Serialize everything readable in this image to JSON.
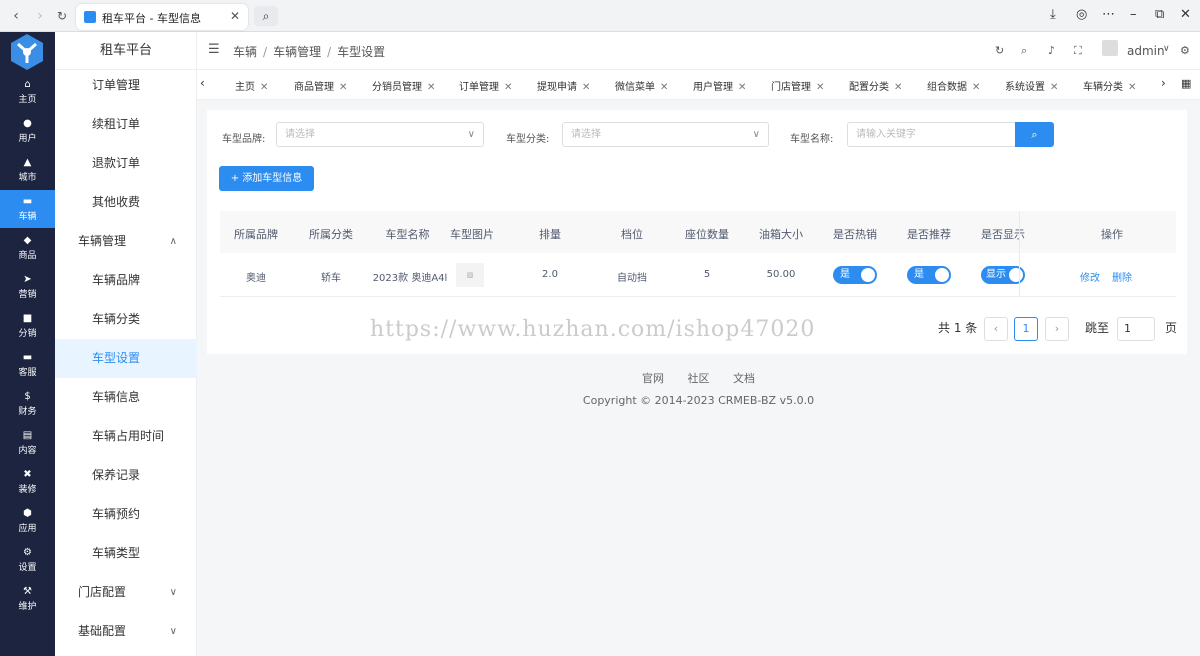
{
  "browser": {
    "tab_title": "租车平台 - 车型信息"
  },
  "sidebar_primary": [
    {
      "label": "主页",
      "icon": "home-icon"
    },
    {
      "label": "用户",
      "icon": "user-icon"
    },
    {
      "label": "城市",
      "icon": "city-icon"
    },
    {
      "label": "车辆",
      "icon": "car-icon"
    },
    {
      "label": "商品",
      "icon": "goods-icon"
    },
    {
      "label": "营销",
      "icon": "marketing-icon"
    },
    {
      "label": "分销",
      "icon": "distribution-icon"
    },
    {
      "label": "客服",
      "icon": "service-icon"
    },
    {
      "label": "财务",
      "icon": "finance-icon"
    },
    {
      "label": "内容",
      "icon": "content-icon"
    },
    {
      "label": "装修",
      "icon": "decorate-icon"
    },
    {
      "label": "应用",
      "icon": "app-icon"
    },
    {
      "label": "设置",
      "icon": "settings-icon"
    },
    {
      "label": "维护",
      "icon": "maintain-icon"
    }
  ],
  "sidebar_secondary": {
    "title": "租车平台",
    "items": [
      "订单管理",
      "续租订单",
      "退款订单",
      "其他收费",
      "车辆管理",
      "车辆品牌",
      "车辆分类",
      "车型设置",
      "车辆信息",
      "车辆占用时间",
      "保养记录",
      "车辆预约",
      "车辆类型",
      "门店配置",
      "基础配置"
    ]
  },
  "breadcrumb": [
    "车辆",
    "车辆管理",
    "车型设置"
  ],
  "user": {
    "name": "admin"
  },
  "tabs": [
    "主页",
    "商品管理",
    "分销员管理",
    "订单管理",
    "提现申请",
    "微信菜单",
    "用户管理",
    "门店管理",
    "配置分类",
    "组合数据",
    "系统设置",
    "车辆分类"
  ],
  "filters": {
    "brand_label": "车型品牌:",
    "brand_placeholder": "请选择",
    "category_label": "车型分类:",
    "category_placeholder": "请选择",
    "name_label": "车型名称:",
    "name_placeholder": "请输入关键字"
  },
  "add_button": "+ 添加车型信息",
  "table": {
    "headers": [
      "所属品牌",
      "所属分类",
      "车型名称",
      "车型图片",
      "排量",
      "档位",
      "座位数量",
      "油箱大小",
      "是否热销",
      "是否推荐",
      "是否显示",
      "操作"
    ],
    "rows": [
      {
        "brand": "奥迪",
        "category": "轿车",
        "name": "2023款 奥迪A4l",
        "displacement": "2.0",
        "gear": "自动挡",
        "seats": "5",
        "tank": "50.00",
        "hot": "是",
        "recommend": "是",
        "show": "显示",
        "edit": "修改",
        "delete": "删除"
      }
    ]
  },
  "pagination": {
    "total": "共 1 条",
    "current": "1",
    "jump_label": "跳至",
    "jump_value": "1",
    "page_suffix": "页"
  },
  "watermark": "https://www.huzhan.com/ishop47020",
  "footer": {
    "links": [
      "官网",
      "社区",
      "文档"
    ],
    "copyright": "Copyright © 2014-2023 CRMEB-BZ v5.0.0"
  },
  "colors": {
    "primary": "#2d8cf0",
    "sidebar_dark": "#1c2440"
  }
}
